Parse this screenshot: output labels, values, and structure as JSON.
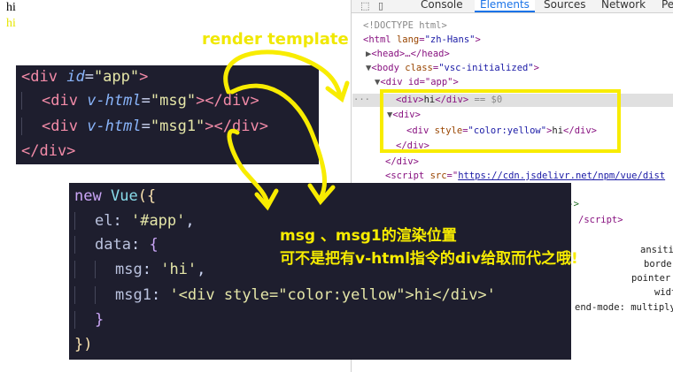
{
  "page": {
    "line1": "hi",
    "line2": "hi"
  },
  "devtools": {
    "tabs": [
      "Console",
      "Elements",
      "Sources",
      "Network",
      "Pe"
    ],
    "active_tab": "Elements",
    "dom": {
      "doctype": "<!DOCTYPE html>",
      "html_open": "<html ",
      "html_attr": "lang",
      "html_val": "\"zh-Hans\"",
      "head": "<head>…</head>",
      "body_open": "<body ",
      "body_attr": "class",
      "body_val": "\"vsc-initialized\"",
      "app_div": "<div id=\"app\">",
      "sel_div_open": "<div>",
      "sel_div_text": "hi",
      "sel_div_close": "</div>",
      "sel_marker": "== $0",
      "div2_open": "<div>",
      "inner_open": "<div ",
      "inner_attr": "style",
      "inner_val": "\"color:yellow\"",
      "inner_text": "hi",
      "inner_close": "</div>",
      "div2_close": "</div>",
      "app_close": "</div>",
      "script_open": "<script ",
      "script_attr": "src",
      "script_val": "https://cdn.jsdelivr.net/npm/vue/dist",
      "comment_tail": "-->",
      "script_close": "/script>",
      "style_frag1": "ansitio",
      "style_frag2": "borde",
      "style_frag3": "pointer",
      "style_frag4": "widt",
      "style_frag5": "end-mode: multiply"
    }
  },
  "code_html": {
    "l1_tag": "<div",
    "l1_attr": "id",
    "l1_val": "\"app\"",
    "l1_end": ">",
    "l2_tag": "<div",
    "l2_attr": "v-html",
    "l2_val": "\"msg\"",
    "l2_end": "></div>",
    "l3_tag": "<div",
    "l3_attr": "v-html",
    "l3_val": "\"msg1\"",
    "l3_end": "></div>",
    "l4": "</div>"
  },
  "code_vue": {
    "kw_new": "new",
    "fn_vue": "Vue",
    "open": "({",
    "el_key": "el",
    "el_val": "'#app'",
    "data_key": "data",
    "msg_key": "msg",
    "msg_val": "'hi'",
    "msg1_key": "msg1",
    "msg1_val": "'<div style=\"color:yellow\">hi</div>'",
    "close_inner": "}",
    "close_outer": "})"
  },
  "annotations": {
    "render_template": "render template",
    "note_line1": "msg 、msg1的渲染位置",
    "note_line2": "可不是把有v-html指令的div给取而代之哦!"
  },
  "colors": {
    "accent_yellow": "#f8ec00",
    "editor_bg": "#1e1e2e"
  }
}
